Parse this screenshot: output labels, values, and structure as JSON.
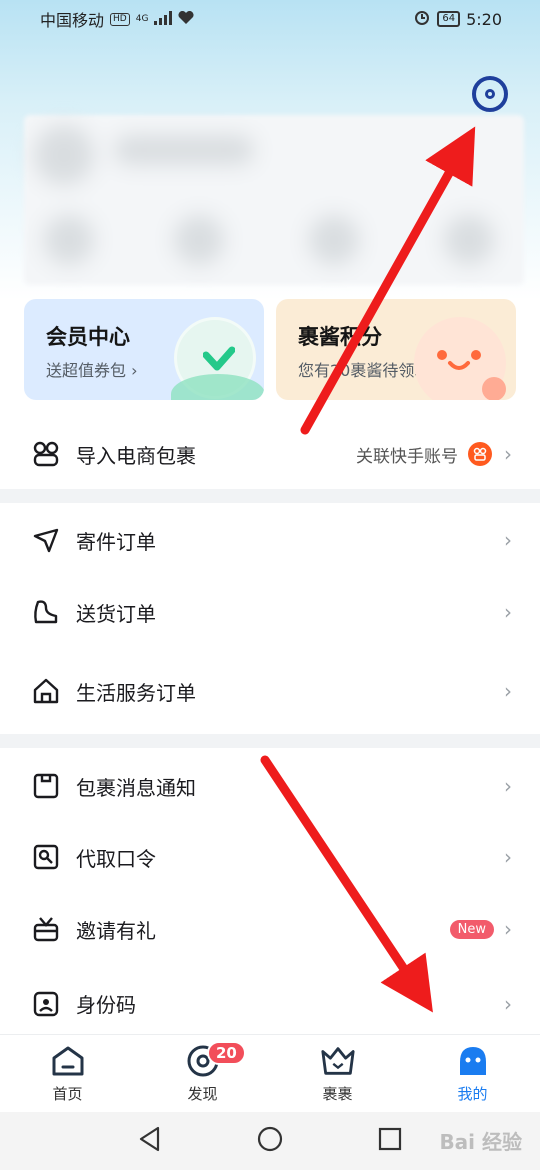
{
  "status_bar": {
    "carrier": "中国移动",
    "hd": "HD",
    "network": "4G",
    "battery": "64",
    "time": "5:20"
  },
  "cards": {
    "member": {
      "title": "会员中心",
      "subtitle": "送超值券包"
    },
    "points": {
      "title": "裹酱积分",
      "subtitle": "您有20裹酱待领取"
    }
  },
  "menu": {
    "import": {
      "label": "导入电商包裹",
      "right_text": "关联快手账号"
    },
    "send_orders": {
      "label": "寄件订单"
    },
    "delivery_orders": {
      "label": "送货订单"
    },
    "life_orders": {
      "label": "生活服务订单"
    },
    "notifications": {
      "label": "包裹消息通知"
    },
    "pickup_code": {
      "label": "代取口令"
    },
    "invite": {
      "label": "邀请有礼",
      "badge": "New"
    },
    "id_code": {
      "label": "身份码"
    }
  },
  "chevron_glyph": "›",
  "tabs": [
    {
      "label": "首页",
      "icon": "home-icon"
    },
    {
      "label": "发现",
      "icon": "discover-icon",
      "badge": "20"
    },
    {
      "label": "裹裹",
      "icon": "crown-box-icon"
    },
    {
      "label": "我的",
      "icon": "profile-icon",
      "active": true
    }
  ],
  "watermark": "Bai 经验",
  "colors": {
    "accent": "#1a7cf0",
    "settings": "#1f3f9c",
    "arrow": "#ee1c1c",
    "new_badge": "#f25b6b"
  }
}
